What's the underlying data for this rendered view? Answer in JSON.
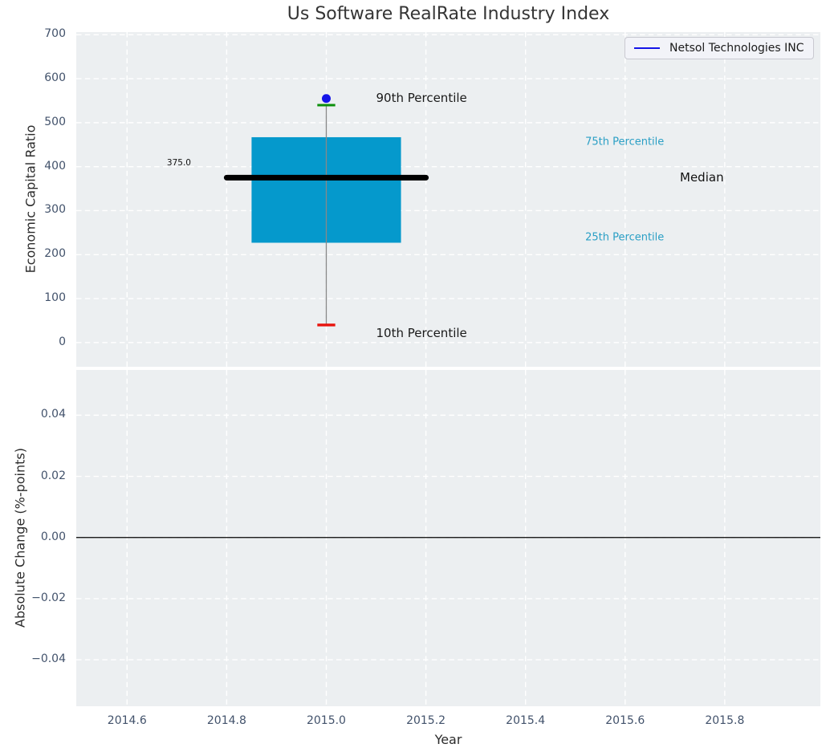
{
  "figure": {
    "title": "Us Software RealRate Industry Index",
    "plot_background": "#eceff1",
    "grid_color": "#ffffff",
    "tick_label_color": "#42526b"
  },
  "legend": {
    "label": "Netsol Technologies INC",
    "line_color": "#1414e8"
  },
  "chart_data": [
    {
      "type": "boxplot",
      "title": "Us Software RealRate Industry Index",
      "ylabel": "Economic Capital Ratio",
      "ylim": [
        -55,
        706
      ],
      "ytick_values": [
        0,
        100,
        200,
        300,
        400,
        500,
        600,
        700
      ],
      "ytick_labels": [
        "0",
        "100",
        "200",
        "300",
        "400",
        "500",
        "600",
        "700"
      ],
      "xlim": [
        2014.498,
        2015.992
      ],
      "xtick_values": [
        2014.6,
        2014.8,
        2015.0,
        2015.2,
        2015.4,
        2015.6,
        2015.8
      ],
      "grid": true,
      "legend_position": "upper right",
      "box": {
        "x": 2015.0,
        "p10": 40,
        "p25": 227,
        "median": 375,
        "p75": 467,
        "p90": 540,
        "box_half_width": 0.15,
        "median_half_width": 0.2,
        "cap_half_width": 0.018,
        "box_color": "#0599cc",
        "whisker_color": "#888888",
        "median_color": "#000000",
        "p90_cap_color": "#0b8f0b",
        "p10_cap_color": "#e8130c"
      },
      "company_marker": {
        "name": "Netsol Technologies INC",
        "x": 2015.0,
        "y": 555,
        "color": "#1414e8",
        "radius": 5.5
      },
      "annotations": [
        {
          "name": "median-value-label",
          "text": "375.0",
          "x": 2014.68,
          "y": 409,
          "color": "#111111",
          "size": 10.5
        },
        {
          "name": "p90-annotation",
          "text": "90th Percentile",
          "x": 2015.1,
          "y": 556,
          "color": "#1a1a1a",
          "size": 15
        },
        {
          "name": "p75-annotation",
          "text": "75th Percentile",
          "x": 2015.52,
          "y": 456,
          "color": "#2a9fc5",
          "size": 13
        },
        {
          "name": "median-annotation",
          "text": "Median",
          "x": 2015.71,
          "y": 376,
          "color": "#111111",
          "size": 15
        },
        {
          "name": "p25-annotation",
          "text": "25th Percentile",
          "x": 2015.52,
          "y": 239,
          "color": "#2a9fc5",
          "size": 13
        },
        {
          "name": "p10-annotation",
          "text": "10th Percentile",
          "x": 2015.1,
          "y": 22,
          "color": "#1a1a1a",
          "size": 15
        }
      ]
    },
    {
      "type": "line",
      "ylabel": "Absolute Change (%-points)",
      "xlabel": "Year",
      "ylim": [
        -0.0552,
        0.0548
      ],
      "ytick_values": [
        0.04,
        0.02,
        0.0,
        -0.02,
        -0.04
      ],
      "ytick_labels": [
        "0.04",
        "0.02",
        "0.00",
        "−0.02",
        "−0.04"
      ],
      "xlim": [
        2014.498,
        2015.992
      ],
      "xtick_values": [
        2014.6,
        2014.8,
        2015.0,
        2015.2,
        2015.4,
        2015.6,
        2015.8
      ],
      "xtick_labels": [
        "2014.6",
        "2014.8",
        "2015.0",
        "2015.2",
        "2015.4",
        "2015.6",
        "2015.8"
      ],
      "grid": true,
      "zero_line": {
        "y": 0.0,
        "color": "#000000"
      },
      "series": []
    }
  ]
}
